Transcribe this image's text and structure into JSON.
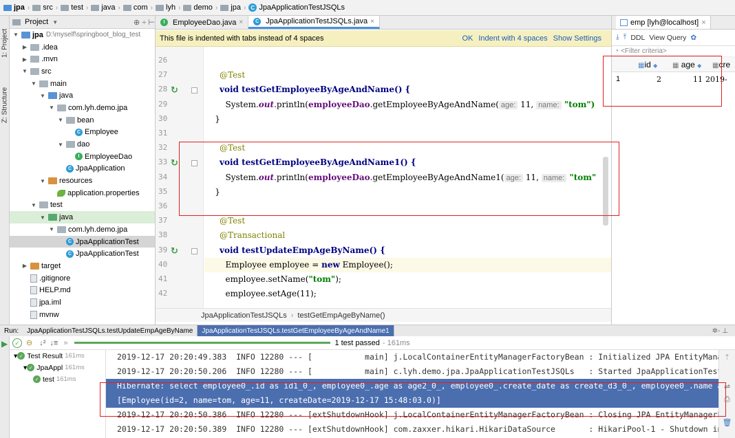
{
  "breadcrumb": [
    "jpa",
    "src",
    "test",
    "java",
    "com",
    "lyh",
    "demo",
    "jpa",
    "JpaApplicationTestJSQLs"
  ],
  "left_strip": {
    "project_tab": "1: Project",
    "structure_tab": "Z: Structure"
  },
  "project": {
    "header": "Project",
    "tree": [
      {
        "label": "jpa",
        "extra": "D:\\myself\\springboot_blog_test",
        "indent": 0,
        "arrow": "down",
        "icon": "folder-blue",
        "bold": true
      },
      {
        "label": ".idea",
        "indent": 1,
        "arrow": "right",
        "icon": "folder"
      },
      {
        "label": ".mvn",
        "indent": 1,
        "arrow": "right",
        "icon": "folder"
      },
      {
        "label": "src",
        "indent": 1,
        "arrow": "down",
        "icon": "folder"
      },
      {
        "label": "main",
        "indent": 2,
        "arrow": "down",
        "icon": "folder"
      },
      {
        "label": "java",
        "indent": 3,
        "arrow": "down",
        "icon": "folder-blue"
      },
      {
        "label": "com.lyh.demo.jpa",
        "indent": 4,
        "arrow": "down",
        "icon": "folder"
      },
      {
        "label": "bean",
        "indent": 5,
        "arrow": "down",
        "icon": "folder"
      },
      {
        "label": "Employee",
        "indent": 6,
        "arrow": "",
        "icon": "class"
      },
      {
        "label": "dao",
        "indent": 5,
        "arrow": "down",
        "icon": "folder"
      },
      {
        "label": "EmployeeDao",
        "indent": 6,
        "arrow": "",
        "icon": "interface"
      },
      {
        "label": "JpaApplication",
        "indent": 5,
        "arrow": "",
        "icon": "class"
      },
      {
        "label": "resources",
        "indent": 3,
        "arrow": "down",
        "icon": "folder-orange"
      },
      {
        "label": "application.properties",
        "indent": 4,
        "arrow": "",
        "icon": "leaf"
      },
      {
        "label": "test",
        "indent": 2,
        "arrow": "down",
        "icon": "folder"
      },
      {
        "label": "java",
        "indent": 3,
        "arrow": "down",
        "icon": "folder-green",
        "row": "green"
      },
      {
        "label": "com.lyh.demo.jpa",
        "indent": 4,
        "arrow": "down",
        "icon": "folder"
      },
      {
        "label": "JpaApplicationTest",
        "indent": 5,
        "arrow": "",
        "icon": "class",
        "row": "sel"
      },
      {
        "label": "JpaApplicationTest",
        "indent": 5,
        "arrow": "",
        "icon": "class"
      },
      {
        "label": "target",
        "indent": 1,
        "arrow": "right",
        "icon": "folder-orange"
      },
      {
        "label": ".gitignore",
        "indent": 1,
        "arrow": "",
        "icon": "file"
      },
      {
        "label": "HELP.md",
        "indent": 1,
        "arrow": "",
        "icon": "file"
      },
      {
        "label": "jpa.iml",
        "indent": 1,
        "arrow": "",
        "icon": "file"
      },
      {
        "label": "mvnw",
        "indent": 1,
        "arrow": "",
        "icon": "file"
      }
    ]
  },
  "editor": {
    "tabs": [
      {
        "label": "EmployeeDao.java",
        "icon": "I"
      },
      {
        "label": "JpaApplicationTestJSQLs.java",
        "icon": "C",
        "active": true
      }
    ],
    "banner": {
      "text": "This file is indented with tabs instead of 4 spaces",
      "ok": "OK",
      "indent": "Indent with 4 spaces",
      "settings": "Show Settings"
    },
    "breadcrumb": [
      "JpaApplicationTestJSQLs",
      "testGetEmpAgeByName()"
    ],
    "lines": [
      {
        "n": "26"
      },
      {
        "n": "27",
        "ann": "@Test"
      },
      {
        "n": "28",
        "run": true,
        "kw": "void",
        "rest": " testGetEmployeeByAgeAndName() {"
      },
      {
        "n": "29",
        "print": true,
        "call": "getEmployeeByAgeAndName",
        "h1": "age:",
        "v1": " 11, ",
        "h2": "name:",
        "s": " \"tom\")"
      },
      {
        "n": "30",
        "rest": "    }"
      },
      {
        "n": "31"
      },
      {
        "n": "32",
        "ann": "@Test"
      },
      {
        "n": "33",
        "run": true,
        "kw": "void",
        "rest": " testGetEmployeeByAgeAndName1() {"
      },
      {
        "n": "34",
        "print": true,
        "call": "getEmployeeByAgeAndName1",
        "h1": "age:",
        "v1": " 11, ",
        "h2": "name:",
        "s": " \"tom\""
      },
      {
        "n": "35",
        "rest": "    }"
      },
      {
        "n": "36"
      },
      {
        "n": "37",
        "ann": "@Test"
      },
      {
        "n": "38",
        "ann": "@Transactional"
      },
      {
        "n": "39",
        "run": true,
        "kw": "void",
        "rest": " testUpdateEmpAgeByName() {"
      },
      {
        "n": "40",
        "hl": true,
        "emp": true
      },
      {
        "n": "41",
        "setname": true
      },
      {
        "n": "42",
        "setage": true
      }
    ]
  },
  "code_text": {
    "sysout_a": "System.",
    "sysout_b": "out",
    "sysout_c": ".println(",
    "dao": "employeeDao",
    "emp_a": "        Employee employee = ",
    "emp_new": "new",
    "emp_b": " Employee();",
    "sn_a": "        employee.setName(",
    "sn_str": "\"tom\"",
    "sn_b": ");",
    "sa": "        employee.setAge(11);"
  },
  "db": {
    "tab": "emp [lyh@localhost]",
    "toolbar": [
      "DDL",
      "View Query"
    ],
    "filter": "<Filter criteria>",
    "columns": [
      "id",
      "age",
      "cre"
    ],
    "row": {
      "num": "1",
      "id": "2",
      "age": "11",
      "cre": "2019-"
    }
  },
  "run": {
    "label": "Run:",
    "tabs": [
      "JpaApplicationTestJSQLs.testUpdateEmpAgeByName",
      "JpaApplicationTestJSQLs.testGetEmployeeByAgeAndName1"
    ],
    "status": "1 test passed",
    "status_time": "- 161ms",
    "tree": [
      {
        "label": "Test Result",
        "time": "161ms",
        "indent": 0
      },
      {
        "label": "JpaAppl",
        "time": "161ms",
        "indent": 1
      },
      {
        "label": "test",
        "time": "161ms",
        "indent": 2
      }
    ],
    "console": [
      "2019-12-17 20:20:49.383  INFO 12280 --- [           main] j.LocalContainerEntityManagerFactoryBean : Initialized JPA EntityManag",
      "2019-12-17 20:20:50.206  INFO 12280 --- [           main] c.lyh.demo.jpa.JpaApplicationTestJSQLs   : Started JpaApplicationTestJ",
      "Hibernate: select employee0_.id as id1_0_, employee0_.age as age2_0_, employee0_.create_date as create_d3_0_, employee0_.name as",
      "[Employee(id=2, name=tom, age=11, createDate=2019-12-17 15:48:03.0)]",
      "2019-12-17 20:20:50.386  INFO 12280 --- [extShutdownHook] j.LocalContainerEntityManagerFactoryBean : Closing JPA EntityManagerFa",
      "2019-12-17 20:20:50.389  INFO 12280 --- [extShutdownHook] com.zaxxer.hikari.HikariDataSource       : HikariPool-1 - Shutdown ini"
    ]
  },
  "colors": {
    "accent": "#4b6eaf",
    "annotation": "#e02020",
    "banner": "#f6f0c1"
  }
}
